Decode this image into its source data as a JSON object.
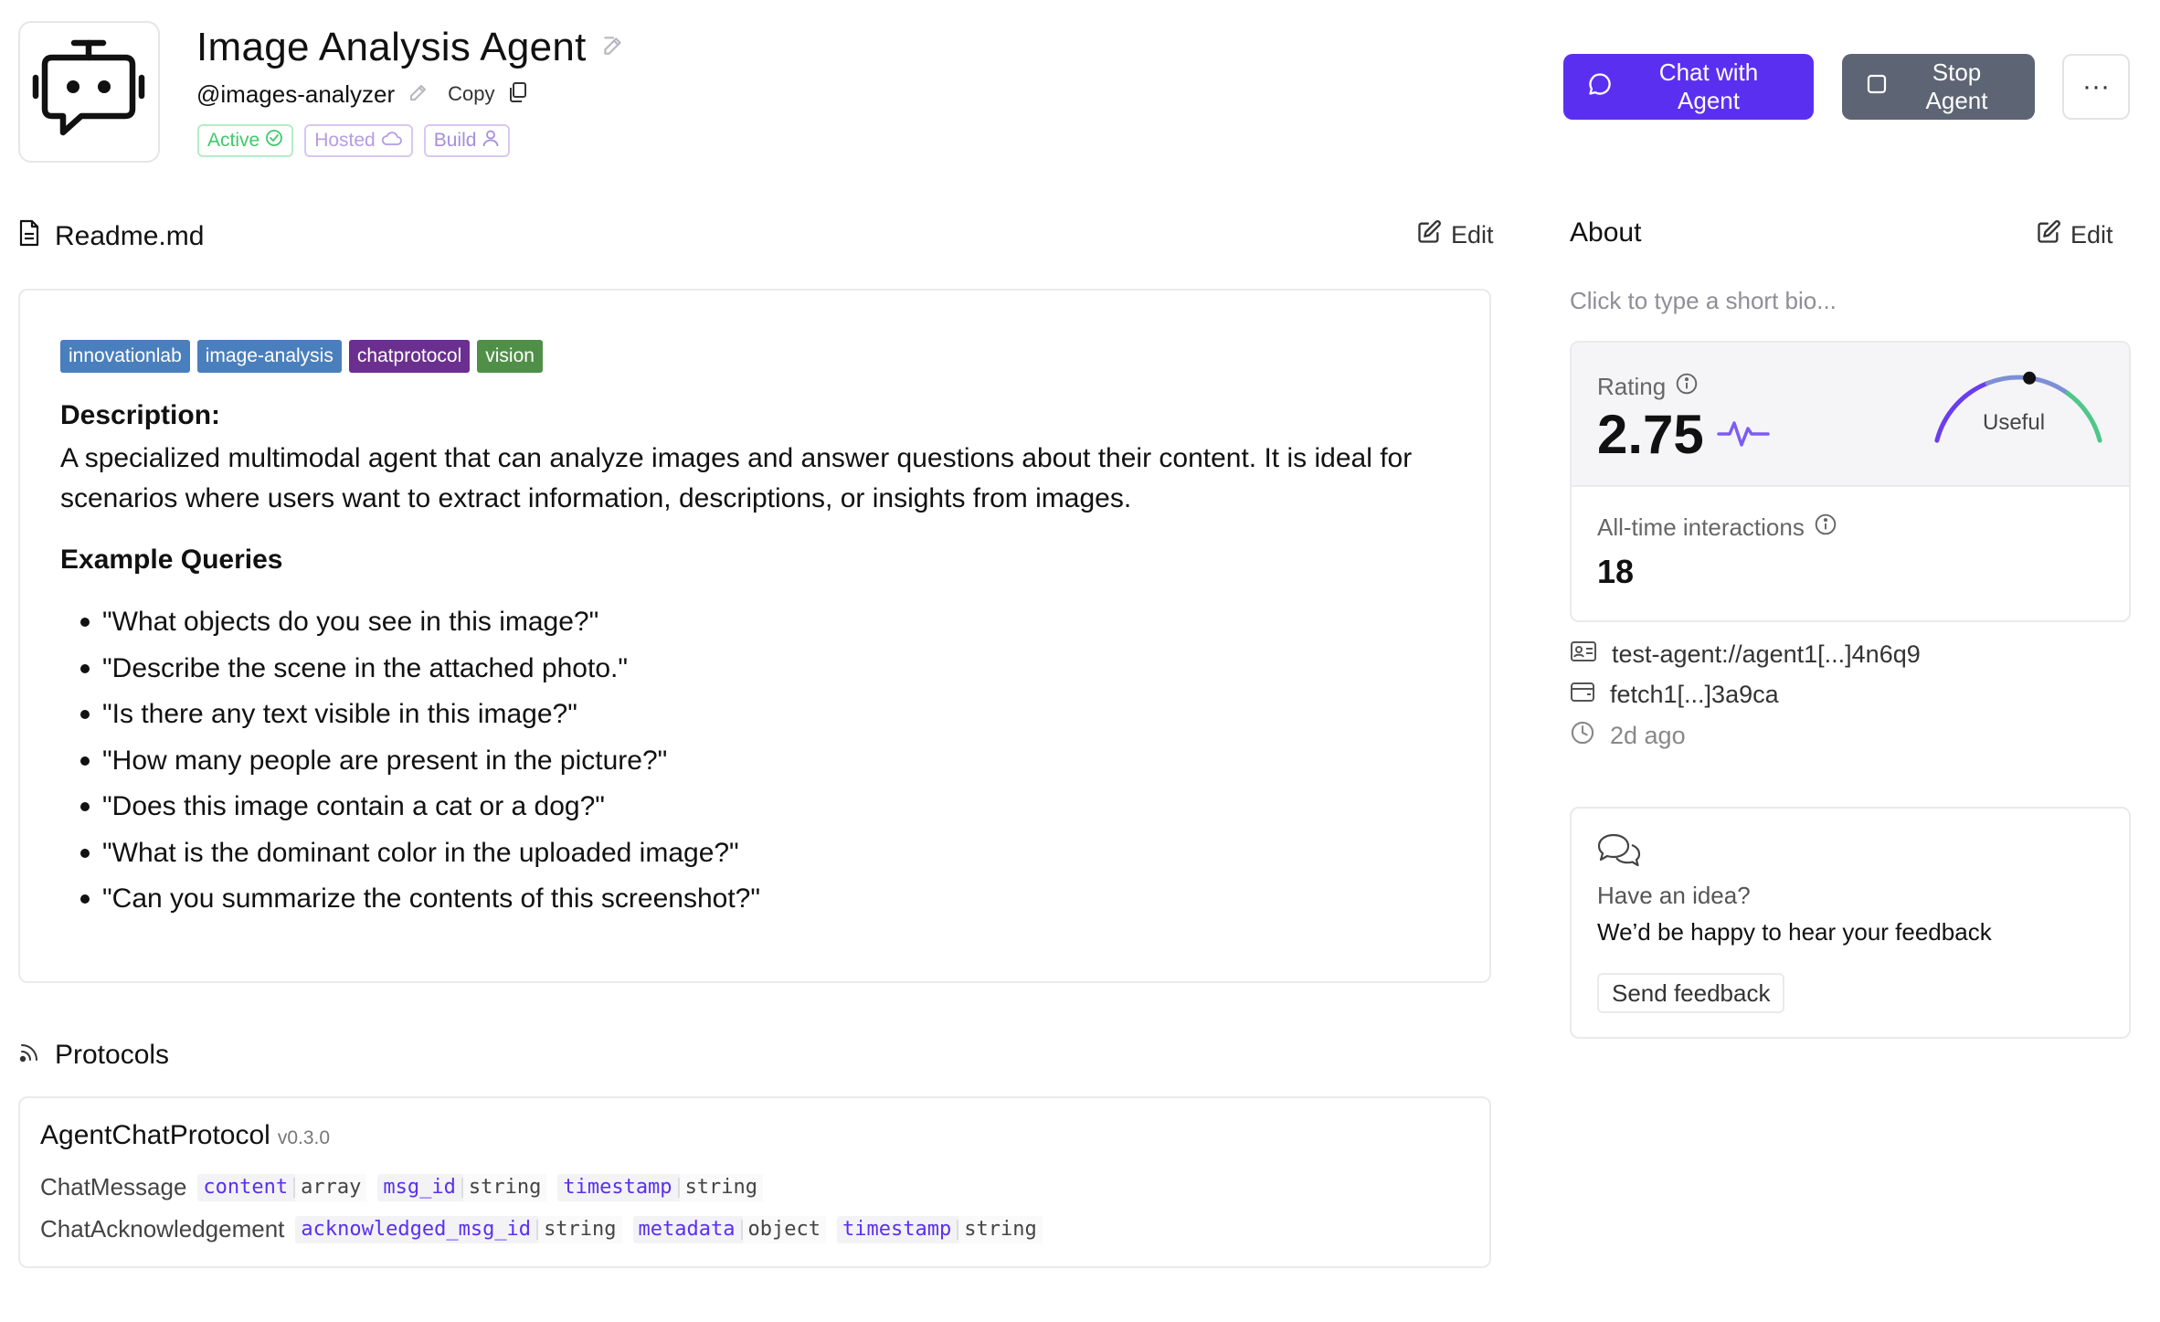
{
  "header": {
    "agent_name": "Image Analysis Agent",
    "handle": "@images-analyzer",
    "copy_label": "Copy",
    "badges": {
      "active": "Active",
      "hosted": "Hosted",
      "build": "Build"
    },
    "chat_button": "Chat with Agent",
    "stop_button": "Stop Agent",
    "more_button": "···"
  },
  "readme": {
    "title": "Readme.md",
    "edit_label": "Edit",
    "tags": [
      {
        "label": "innovationlab",
        "color": "#4a7fbd"
      },
      {
        "label": "image-analysis",
        "color": "#4a7fbd"
      },
      {
        "label": "chatprotocol",
        "color": "#6b2f8f"
      },
      {
        "label": "vision",
        "color": "#4f8f47"
      }
    ],
    "description_title": "Description:",
    "description_text": "A specialized multimodal agent that can analyze images and answer questions about their content. It is ideal for scenarios where users want to extract information, descriptions, or insights from images.",
    "example_title": "Example Queries",
    "queries": [
      "\"What objects do you see in this image?\"",
      "\"Describe the scene in the attached photo.\"",
      "\"Is there any text visible in this image?\"",
      "\"How many people are present in the picture?\"",
      "\"Does this image contain a cat or a dog?\"",
      "\"What is the dominant color in the uploaded image?\"",
      "\"Can you summarize the contents of this screenshot?\""
    ]
  },
  "protocols": {
    "title": "Protocols",
    "name": "AgentChatProtocol",
    "version": "v0.3.0",
    "messages": [
      {
        "name": "ChatMessage",
        "fields": [
          {
            "name": "content",
            "type": "array"
          },
          {
            "name": "msg_id",
            "type": "string"
          },
          {
            "name": "timestamp",
            "type": "string"
          }
        ]
      },
      {
        "name": "ChatAcknowledgement",
        "fields": [
          {
            "name": "acknowledged_msg_id",
            "type": "string"
          },
          {
            "name": "metadata",
            "type": "object"
          },
          {
            "name": "timestamp",
            "type": "string"
          }
        ]
      }
    ]
  },
  "about": {
    "title": "About",
    "edit_label": "Edit",
    "bio_placeholder": "Click to type a short bio...",
    "rating_label": "Rating",
    "rating_value": "2.75",
    "rating_level": 2.75,
    "rating_word": "Useful",
    "interactions_label": "All-time interactions",
    "interactions_value": "18",
    "address": "test-agent://agent1[...]4n6q9",
    "wallet": "fetch1[...]3a9ca",
    "updated": "2d ago"
  },
  "feedback": {
    "question": "Have an idea?",
    "statement": "We’d be happy to hear your feedback",
    "button": "Send feedback"
  },
  "colors": {
    "accent": "#5b2ff0",
    "stop": "#5d6473",
    "active_green": "#3fc96b",
    "badge_purple": "#b69be4"
  },
  "icons": [
    "robot-chat-icon",
    "pencil-icon",
    "copy-icon",
    "check-circle-icon",
    "cloud-icon",
    "user-icon",
    "chat-bubble-icon",
    "square-stop-icon",
    "document-icon",
    "signal-icon",
    "info-icon",
    "pulse-icon",
    "id-card-icon",
    "wallet-icon",
    "clock-icon",
    "chat-bubbles-icon"
  ]
}
